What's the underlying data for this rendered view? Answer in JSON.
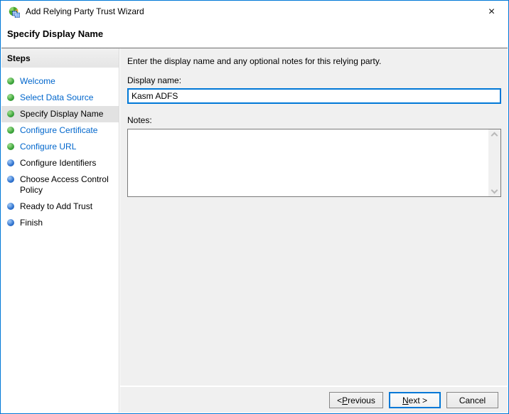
{
  "window": {
    "title": "Add Relying Party Trust Wizard",
    "close_icon": "×"
  },
  "header": {
    "title": "Specify Display Name"
  },
  "sidebar": {
    "heading": "Steps",
    "items": [
      {
        "label": "Welcome",
        "state": "completed-link",
        "bullet": "green"
      },
      {
        "label": "Select Data Source",
        "state": "completed-link",
        "bullet": "green"
      },
      {
        "label": "Specify Display Name",
        "state": "current",
        "bullet": "green"
      },
      {
        "label": "Configure Certificate",
        "state": "completed-link",
        "bullet": "green"
      },
      {
        "label": "Configure URL",
        "state": "completed-link",
        "bullet": "green"
      },
      {
        "label": "Configure Identifiers",
        "state": "upcoming",
        "bullet": "blue"
      },
      {
        "label": "Choose Access Control Policy",
        "state": "upcoming",
        "bullet": "blue"
      },
      {
        "label": "Ready to Add Trust",
        "state": "upcoming",
        "bullet": "blue"
      },
      {
        "label": "Finish",
        "state": "upcoming",
        "bullet": "blue"
      }
    ]
  },
  "main": {
    "description": "Enter the display name and any optional notes for this relying party.",
    "display_name": {
      "label": "Display name:",
      "value": "Kasm ADFS"
    },
    "notes": {
      "label": "Notes:",
      "value": ""
    },
    "notes_scrollbar": {
      "up_icon": "chevron-up",
      "down_icon": "chevron-down"
    }
  },
  "footer": {
    "previous": {
      "pre": "< ",
      "mnemonic": "P",
      "post": "revious"
    },
    "next": {
      "pre": "",
      "mnemonic": "N",
      "post": "ext >"
    },
    "cancel": {
      "label": "Cancel"
    }
  },
  "colors": {
    "accent": "#0078d7",
    "link": "#0066cc",
    "bullet_done": "#3aa43a",
    "bullet_upcoming": "#2e72cf",
    "main_bg": "#f0f0f0"
  }
}
